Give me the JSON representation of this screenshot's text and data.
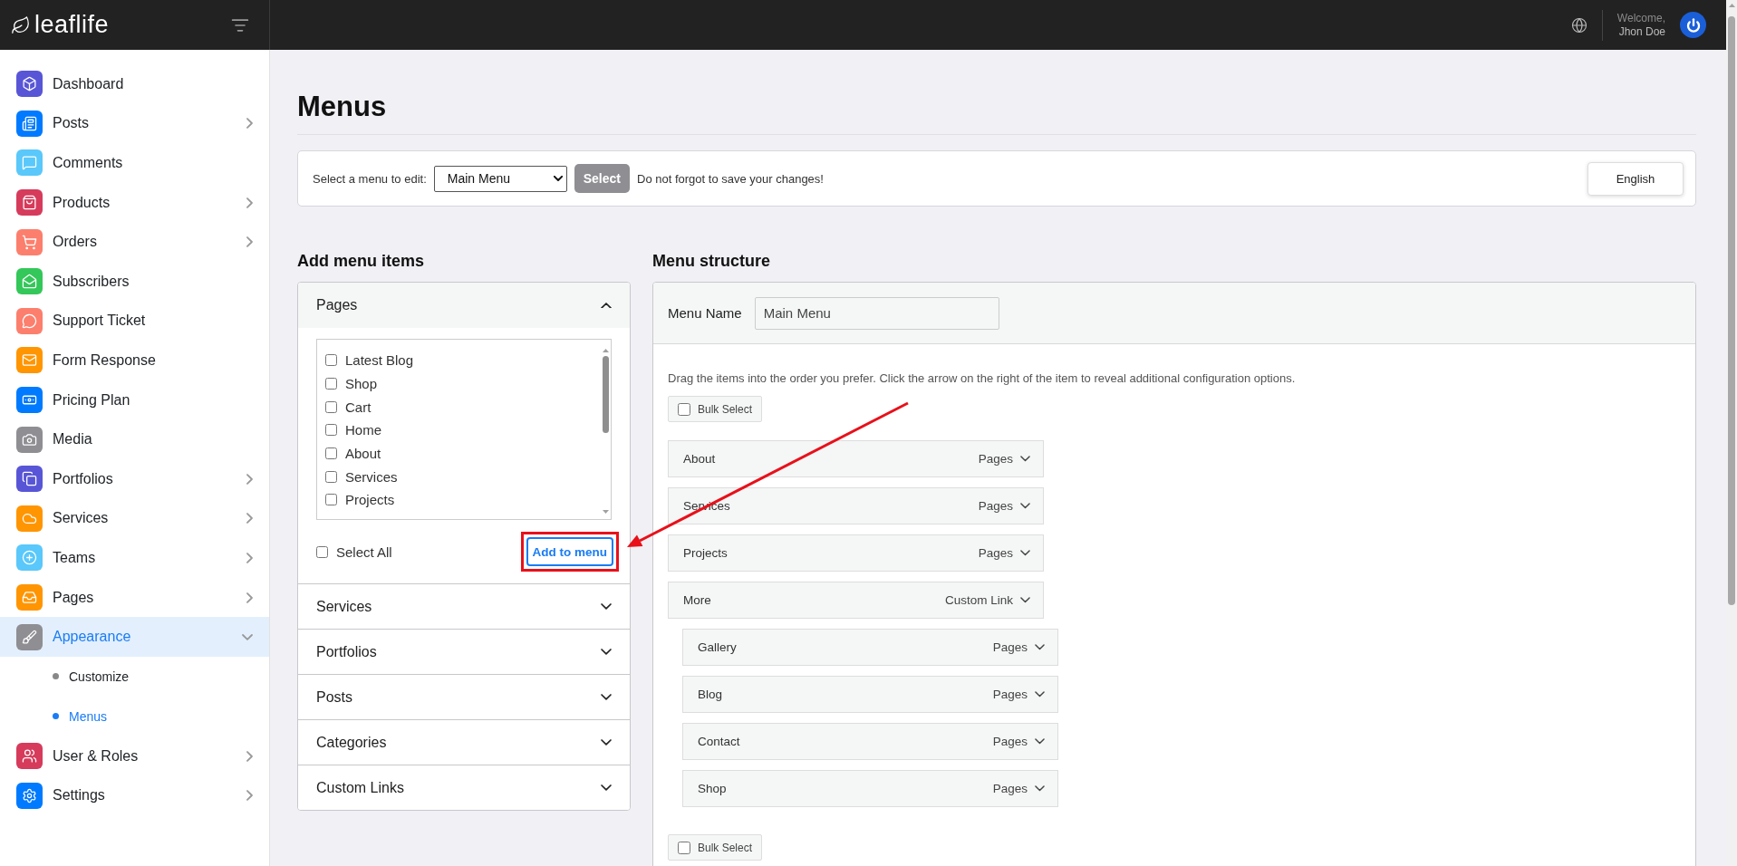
{
  "brand": {
    "name": "leaflife"
  },
  "header": {
    "welcome": "Welcome,",
    "user_name": "Jhon Doe"
  },
  "sidebar": {
    "items": [
      {
        "label": "Dashboard",
        "color": "#5856d6",
        "has_submenu": false,
        "expanded": false,
        "selected": false
      },
      {
        "label": "Posts",
        "color": "#007aff",
        "has_submenu": true,
        "expanded": false,
        "selected": false
      },
      {
        "label": "Comments",
        "color": "#5ac8fa",
        "has_submenu": false,
        "expanded": false,
        "selected": false
      },
      {
        "label": "Products",
        "color": "#d63b5c",
        "has_submenu": true,
        "expanded": false,
        "selected": false
      },
      {
        "label": "Orders",
        "color": "#fc7f6d",
        "has_submenu": true,
        "expanded": false,
        "selected": false
      },
      {
        "label": "Subscribers",
        "color": "#34c759",
        "has_submenu": false,
        "expanded": false,
        "selected": false
      },
      {
        "label": "Support Ticket",
        "color": "#fc7f6d",
        "has_submenu": false,
        "expanded": false,
        "selected": false
      },
      {
        "label": "Form Response",
        "color": "#ff9500",
        "has_submenu": false,
        "expanded": false,
        "selected": false
      },
      {
        "label": "Pricing Plan",
        "color": "#007aff",
        "has_submenu": false,
        "expanded": false,
        "selected": false
      },
      {
        "label": "Media",
        "color": "#8e8e93",
        "has_submenu": false,
        "expanded": false,
        "selected": false
      },
      {
        "label": "Portfolios",
        "color": "#5856d6",
        "has_submenu": true,
        "expanded": false,
        "selected": false
      },
      {
        "label": "Services",
        "color": "#ff9500",
        "has_submenu": true,
        "expanded": false,
        "selected": false
      },
      {
        "label": "Teams",
        "color": "#5ac8fa",
        "has_submenu": true,
        "expanded": false,
        "selected": false
      },
      {
        "label": "Pages",
        "color": "#ff9500",
        "has_submenu": true,
        "expanded": false,
        "selected": false
      },
      {
        "label": "Appearance",
        "color": "#8e8e93",
        "has_submenu": true,
        "expanded": true,
        "selected": true,
        "children": [
          {
            "label": "Customize",
            "selected": false
          },
          {
            "label": "Menus",
            "selected": true
          }
        ]
      },
      {
        "label": "User & Roles",
        "color": "#d63b5c",
        "has_submenu": true,
        "expanded": false,
        "selected": false
      },
      {
        "label": "Settings",
        "color": "#007aff",
        "has_submenu": true,
        "expanded": false,
        "selected": false
      }
    ]
  },
  "page": {
    "title": "Menus"
  },
  "menu_select": {
    "label": "Select a menu to edit:",
    "value": "Main Menu",
    "button": "Select",
    "note": "Do not forgot to save your changes!",
    "language_button": "English"
  },
  "add_items": {
    "heading": "Add menu items",
    "sections": [
      {
        "title": "Pages",
        "expanded": true,
        "options": [
          {
            "label": "Latest Blog",
            "checked": false
          },
          {
            "label": "Shop",
            "checked": false
          },
          {
            "label": "Cart",
            "checked": false
          },
          {
            "label": "Home",
            "checked": false
          },
          {
            "label": "About",
            "checked": false
          },
          {
            "label": "Services",
            "checked": false
          },
          {
            "label": "Projects",
            "checked": false
          }
        ],
        "select_all": {
          "label": "Select All",
          "checked": false
        },
        "add_button": "Add to menu"
      },
      {
        "title": "Services",
        "expanded": false
      },
      {
        "title": "Portfolios",
        "expanded": false
      },
      {
        "title": "Posts",
        "expanded": false
      },
      {
        "title": "Categories",
        "expanded": false
      },
      {
        "title": "Custom Links",
        "expanded": false
      }
    ]
  },
  "structure": {
    "heading": "Menu structure",
    "name_label": "Menu Name",
    "name_value": "Main Menu",
    "instructions": "Drag the items into the order you prefer. Click the arrow on the right of the item to reveal additional configuration options.",
    "bulk_select_top": {
      "label": "Bulk Select",
      "checked": false
    },
    "items": [
      {
        "label": "About",
        "type": "Pages"
      },
      {
        "label": "Services",
        "type": "Pages"
      },
      {
        "label": "Projects",
        "type": "Pages"
      },
      {
        "label": "More",
        "type": "Custom Link",
        "children": [
          {
            "label": "Gallery",
            "type": "Pages"
          },
          {
            "label": "Blog",
            "type": "Pages"
          },
          {
            "label": "Contact",
            "type": "Pages"
          },
          {
            "label": "Shop",
            "type": "Pages"
          }
        ]
      }
    ],
    "bulk_select_bottom": {
      "label": "Bulk Select",
      "checked": false
    }
  }
}
